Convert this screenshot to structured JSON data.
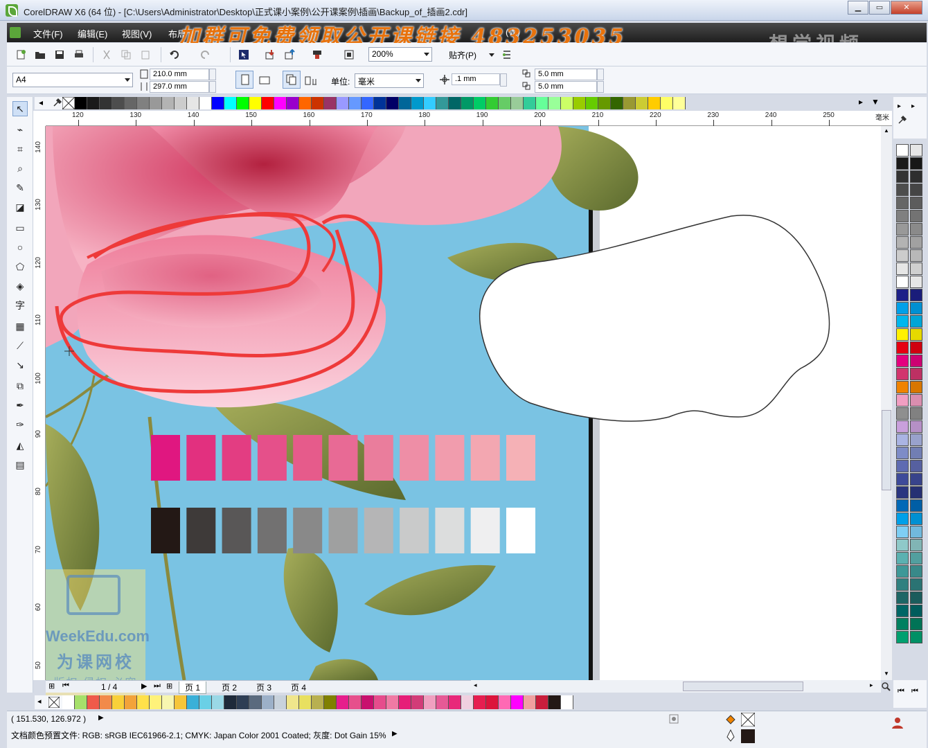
{
  "window": {
    "title": "CorelDRAW X6 (64 位) - [C:\\Users\\Administrator\\Desktop\\正式课小案例\\公开课案例\\插画\\Backup_of_插画2.cdr]",
    "minimize": "▁",
    "maximize": "▭",
    "close": "✕"
  },
  "menu": {
    "file": "文件(F)",
    "edit": "编辑(E)",
    "view": "视图(V)",
    "layout": "布局",
    "window": "(W)"
  },
  "overlay": {
    "promo": "加群可免费领取公开课链接 483253035",
    "watermark": "想学视频"
  },
  "toolbar1": {
    "zoom": "200%",
    "snap": "贴齐(P)"
  },
  "toolbar2": {
    "page_size": "A4",
    "width": "210.0 mm",
    "height": "297.0 mm",
    "units_label": "单位:",
    "units": "毫米",
    "nudge": ".1 mm",
    "dup_x": "5.0 mm",
    "dup_y": "5.0 mm"
  },
  "ruler": {
    "h_ticks": [
      "120",
      "130",
      "140",
      "150",
      "160",
      "170",
      "180",
      "190",
      "200",
      "210",
      "220",
      "230",
      "240",
      "250"
    ],
    "h_unit": "毫米",
    "v_ticks": [
      "140",
      "130",
      "120",
      "110",
      "100",
      "90",
      "80",
      "70",
      "60",
      "50"
    ]
  },
  "pages": {
    "counter": "1 / 4",
    "tabs": [
      "页 1",
      "页 2",
      "页 3",
      "页 4"
    ],
    "active": "页 1"
  },
  "status": {
    "coords": "( 151.530, 126.972 )",
    "profile": "文档颜色预置文件: RGB: sRGB IEC61966-2.1; CMYK: Japan Color 2001 Coated; 灰度: Dot Gain 15%"
  },
  "watermark_logo": {
    "brand": "WeekEdu.com",
    "cn": "为课网校",
    "sub": "版权 侵权 必究"
  },
  "colors": {
    "pink_swatches": [
      "#e01780",
      "#e2307f",
      "#e33d82",
      "#e5508a",
      "#e65b8b",
      "#e86a95",
      "#ea7d9c",
      "#ee8ea6",
      "#f19cad",
      "#f3a7b1",
      "#f5b1b6"
    ],
    "gray_swatches": [
      "#231815",
      "#3e3a39",
      "#595757",
      "#727171",
      "#898989",
      "#9fa0a0",
      "#b5b5b6",
      "#c9caca",
      "#dcdddd",
      "#efeff0",
      "#ffffff"
    ],
    "top_palette": [
      "#000000",
      "#1a1a1a",
      "#333333",
      "#4d4d4d",
      "#666666",
      "#808080",
      "#999999",
      "#b3b3b3",
      "#cccccc",
      "#e6e6e6",
      "#ffffff",
      "#0000ff",
      "#00ffff",
      "#00ff00",
      "#ffff00",
      "#ff0000",
      "#ff00ff",
      "#9900cc",
      "#ff6600",
      "#cc3300",
      "#993366",
      "#9999ff",
      "#6699ff",
      "#3366ff",
      "#003399",
      "#000066",
      "#006699",
      "#0099cc",
      "#33ccff",
      "#339999",
      "#006666",
      "#009966",
      "#00cc66",
      "#33cc33",
      "#66cc66",
      "#99cc99",
      "#33cc99",
      "#66ff99",
      "#99ff99",
      "#ccff66",
      "#99cc00",
      "#66cc00",
      "#669900",
      "#336600",
      "#999933",
      "#cccc33",
      "#ffcc00",
      "#ffff66",
      "#ffff99"
    ],
    "right_palette_a": [
      "#ffffff",
      "#1a1a1a",
      "#333333",
      "#4d4d4d",
      "#666666",
      "#808080",
      "#999999",
      "#b3b3b3",
      "#cccccc",
      "#e6e6e6",
      "#ffffff",
      "#1d2088",
      "#00a0e9",
      "#00b7ee",
      "#fff100",
      "#e60012",
      "#e4007f",
      "#d2356e",
      "#f08300",
      "#f19ec2",
      "#8f8f8f",
      "#c9a0dc",
      "#aab4e3",
      "#7e8cc7",
      "#5f6bb2",
      "#3e4a9a",
      "#2a3580",
      "#0068b7",
      "#00a0e9",
      "#7ecef4",
      "#8fc9c9",
      "#5bb1b1",
      "#3e9898",
      "#2f8080",
      "#1d6666",
      "#006666",
      "#008060",
      "#00a070"
    ],
    "bottom_palette": [
      "#ffffff",
      "#a6e06b",
      "#ef5a4a",
      "#f28a4a",
      "#f9d03a",
      "#f3a33a",
      "#ffe14a",
      "#fff27a",
      "#f7f6b0",
      "#f6c63a",
      "#3ab0d8",
      "#6ad0e6",
      "#9ad8e6",
      "#1e2a3a",
      "#2e3e54",
      "#5a6a7e",
      "#9cb0c8",
      "#c8d2dc",
      "#f0e68c",
      "#e8e060",
      "#b8b050",
      "#808000",
      "#e61e8c",
      "#e6508c",
      "#c8106e",
      "#e64c8c",
      "#f07aa4",
      "#e61e78",
      "#d23c78",
      "#f0a0c0",
      "#e65a96",
      "#e8287a",
      "#f0d0e0",
      "#e61e50",
      "#dc143c",
      "#ff69b4",
      "#ff00ff",
      "#f0a0a0",
      "#c81e3c",
      "#231815",
      "#ffffff"
    ]
  }
}
